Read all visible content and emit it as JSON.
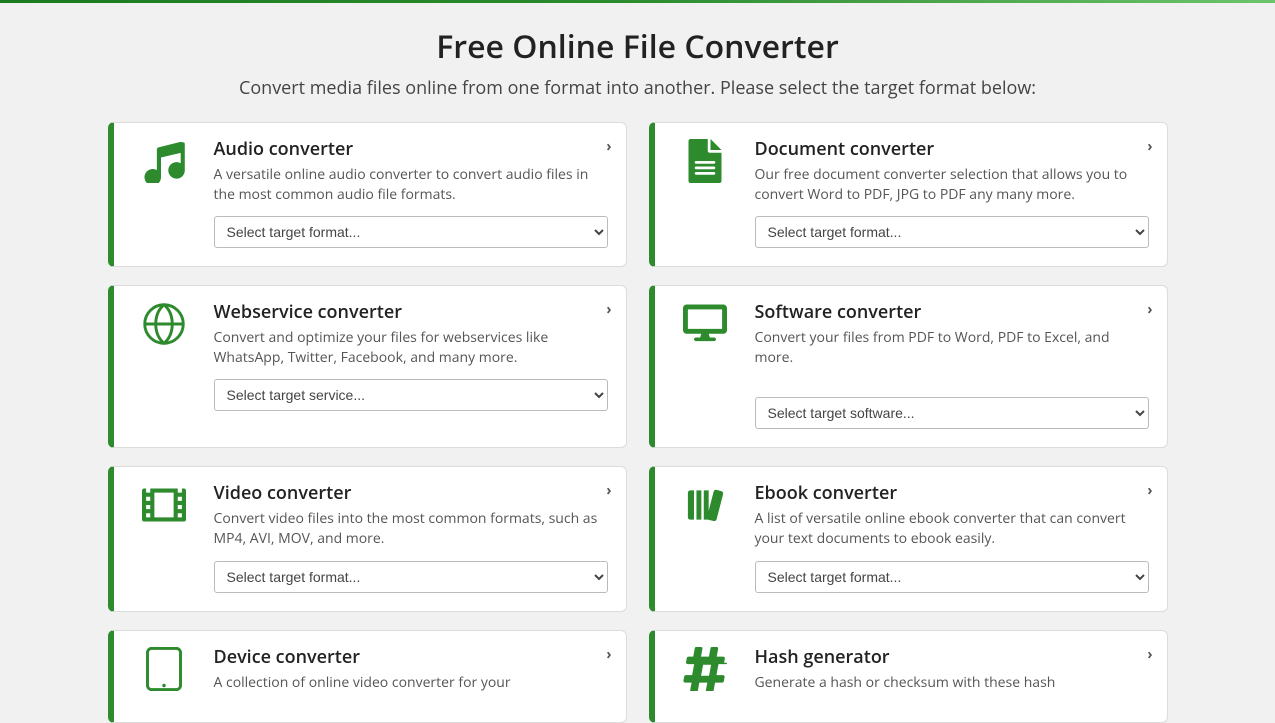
{
  "title": "Free Online File Converter",
  "subtitle": "Convert media files online from one format into another. Please select the target format below:",
  "select_defaults": {
    "format": "Select target format...",
    "service": "Select target service...",
    "software": "Select target software..."
  },
  "cards": [
    {
      "title": "Audio converter",
      "desc": "A versatile online audio converter to convert audio files in the most common audio file formats.",
      "select": "format",
      "icon": "music"
    },
    {
      "title": "Document converter",
      "desc": "Our free document converter selection that allows you to convert Word to PDF, JPG to PDF any many more.",
      "select": "format",
      "icon": "doc"
    },
    {
      "title": "Webservice converter",
      "desc": "Convert and optimize your files for webservices like WhatsApp, Twitter, Facebook, and many more.",
      "select": "service",
      "icon": "globe"
    },
    {
      "title": "Software converter",
      "desc": "Convert your files from PDF to Word, PDF to Excel, and more.",
      "select": "software",
      "icon": "monitor"
    },
    {
      "title": "Video converter",
      "desc": "Convert video files into the most common formats, such as MP4, AVI, MOV, and more.",
      "select": "format",
      "icon": "film"
    },
    {
      "title": "Ebook converter",
      "desc": "A list of versatile online ebook converter that can convert your text documents to ebook easily.",
      "select": "format",
      "icon": "books"
    },
    {
      "title": "Device converter",
      "desc": "A collection of online video converter for your",
      "select": null,
      "icon": "tablet"
    },
    {
      "title": "Hash generator",
      "desc": "Generate a hash or checksum with these hash",
      "select": null,
      "icon": "hash"
    }
  ]
}
